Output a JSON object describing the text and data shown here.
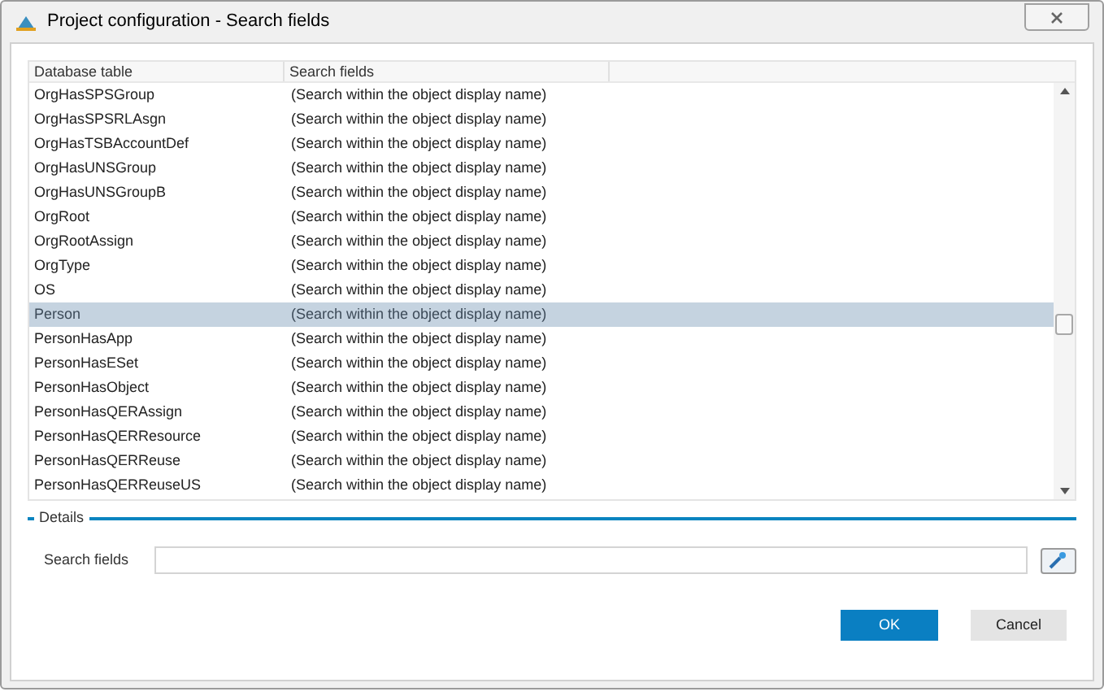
{
  "window": {
    "title": "Project configuration - Search fields"
  },
  "table": {
    "columns": [
      "Database table",
      "Search fields"
    ],
    "rows": [
      {
        "table": "OrgHasSPSGroup",
        "fields": "(Search within the object display name)",
        "selected": false
      },
      {
        "table": "OrgHasSPSRLAsgn",
        "fields": "(Search within the object display name)",
        "selected": false
      },
      {
        "table": "OrgHasTSBAccountDef",
        "fields": "(Search within the object display name)",
        "selected": false
      },
      {
        "table": "OrgHasUNSGroup",
        "fields": "(Search within the object display name)",
        "selected": false
      },
      {
        "table": "OrgHasUNSGroupB",
        "fields": "(Search within the object display name)",
        "selected": false
      },
      {
        "table": "OrgRoot",
        "fields": "(Search within the object display name)",
        "selected": false
      },
      {
        "table": "OrgRootAssign",
        "fields": "(Search within the object display name)",
        "selected": false
      },
      {
        "table": "OrgType",
        "fields": "(Search within the object display name)",
        "selected": false
      },
      {
        "table": "OS",
        "fields": "(Search within the object display name)",
        "selected": false
      },
      {
        "table": "Person",
        "fields": "(Search within the object display name)",
        "selected": true
      },
      {
        "table": "PersonHasApp",
        "fields": "(Search within the object display name)",
        "selected": false
      },
      {
        "table": "PersonHasESet",
        "fields": "(Search within the object display name)",
        "selected": false
      },
      {
        "table": "PersonHasObject",
        "fields": "(Search within the object display name)",
        "selected": false
      },
      {
        "table": "PersonHasQERAssign",
        "fields": "(Search within the object display name)",
        "selected": false
      },
      {
        "table": "PersonHasQERResource",
        "fields": "(Search within the object display name)",
        "selected": false
      },
      {
        "table": "PersonHasQERReuse",
        "fields": "(Search within the object display name)",
        "selected": false
      },
      {
        "table": "PersonHasQERReuseUS",
        "fields": "(Search within the object display name)",
        "selected": false
      }
    ]
  },
  "details": {
    "title": "Details",
    "label": "Search fields"
  },
  "buttons": [
    {
      "label": "OK",
      "kind": "primary"
    },
    {
      "label": "Cancel",
      "kind": "secondary"
    }
  ]
}
